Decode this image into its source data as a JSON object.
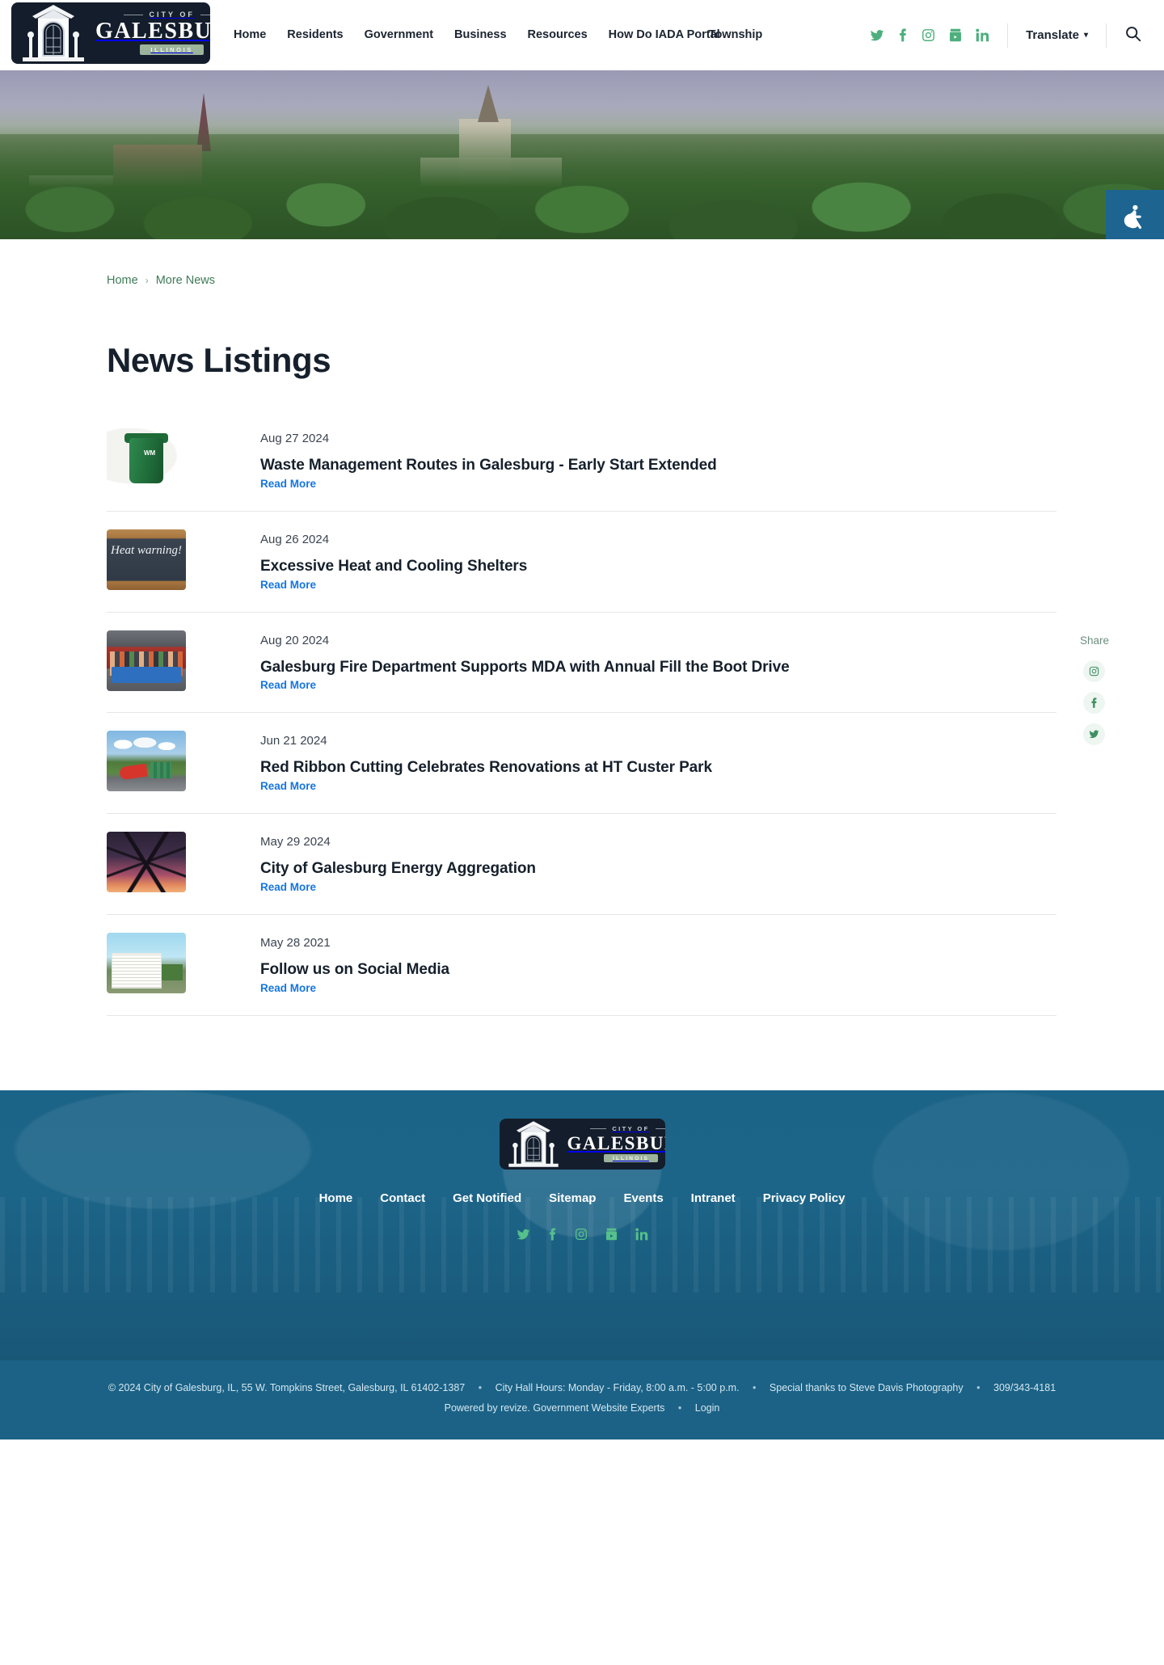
{
  "header": {
    "logo": {
      "city_of": "CITY OF",
      "name": "GALESBURG",
      "state": "ILLINOIS"
    },
    "nav": [
      {
        "label": "Home"
      },
      {
        "label": "Residents"
      },
      {
        "label": "Government"
      },
      {
        "label": "Business"
      },
      {
        "label": "Resources"
      },
      {
        "label": "How Do I"
      },
      {
        "label": "ADA Portal"
      },
      {
        "label": "Township"
      }
    ],
    "social": [
      {
        "name": "twitter-icon"
      },
      {
        "name": "facebook-icon"
      },
      {
        "name": "instagram-icon"
      },
      {
        "name": "youtube-icon"
      },
      {
        "name": "linkedin-icon"
      }
    ],
    "translate_label": "Translate",
    "search_label": "Search"
  },
  "hero": {
    "accessibility_label": "Accessibility options"
  },
  "breadcrumb": {
    "home": "Home",
    "separator": "›",
    "current": "More News"
  },
  "main": {
    "page_title": "News Listings",
    "read_more_label": "Read More",
    "news": [
      {
        "date": "Aug 27 2024",
        "title": "Waste Management Routes in Galesburg - Early Start Extended",
        "read_more": "Read More",
        "thumb": "waste-cart-photo"
      },
      {
        "date": "Aug 26 2024",
        "title": "Excessive Heat and Cooling Shelters",
        "read_more": "Read More",
        "thumb": "heat-warning-chalkboard-photo",
        "thumb_text": "Heat warning!"
      },
      {
        "date": "Aug 20 2024",
        "title": "Galesburg Fire Department Supports MDA with Annual Fill the Boot Drive",
        "read_more": "Read More",
        "thumb": "firefighters-group-photo"
      },
      {
        "date": "Jun 21 2024",
        "title": "Red Ribbon Cutting Celebrates Renovations at HT Custer Park",
        "read_more": "Read More",
        "thumb": "park-playground-photo"
      },
      {
        "date": "May 29 2024",
        "title": "City of Galesburg Energy Aggregation",
        "read_more": "Read More",
        "thumb": "power-transmission-tower-photo"
      },
      {
        "date": "May 28 2021",
        "title": "Follow us on Social Media",
        "read_more": "Read More",
        "thumb": "city-government-channel-photo"
      }
    ]
  },
  "share": {
    "label": "Share",
    "buttons": [
      {
        "name": "instagram-share"
      },
      {
        "name": "facebook-share"
      },
      {
        "name": "twitter-share"
      }
    ]
  },
  "footer": {
    "logo": {
      "city_of": "CITY OF",
      "name": "GALESBURG",
      "state": "ILLINOIS"
    },
    "nav": [
      {
        "label": "Home"
      },
      {
        "label": "Contact"
      },
      {
        "label": "Get Notified"
      },
      {
        "label": "Sitemap"
      },
      {
        "label": "Events"
      },
      {
        "label": "Intranet"
      },
      {
        "label": "Privacy Policy"
      }
    ],
    "social": [
      {
        "name": "twitter-icon"
      },
      {
        "name": "facebook-icon"
      },
      {
        "name": "instagram-icon"
      },
      {
        "name": "youtube-icon"
      },
      {
        "name": "linkedin-icon"
      }
    ],
    "copyright": {
      "line1_a": "© 2024 City of Galesburg, IL, 55 W. Tompkins Street, Galesburg, IL 61402-1387",
      "line1_b": "City Hall Hours: Monday - Friday, 8:00 a.m. - 5:00 p.m.",
      "line1_c": "Special thanks to Steve Davis Photography",
      "line1_d": "309/343-4181",
      "line2_a": "Powered by revize. Government Website Experts",
      "line2_b": "Login",
      "separator": "•"
    }
  },
  "colors": {
    "brand_dark": "#141d2b",
    "accent_green": "#4caf7d",
    "link_blue": "#1675e0",
    "footer_blue": "#1b6286",
    "breadcrumb_green": "#3f7a58"
  }
}
